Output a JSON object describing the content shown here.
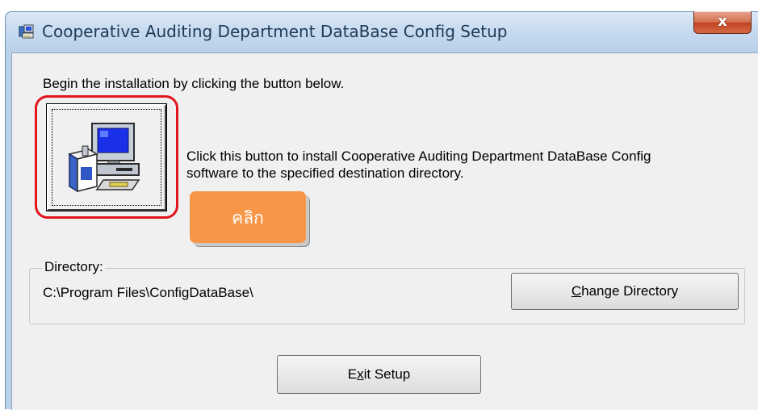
{
  "window": {
    "title": "Cooperative Auditing Department DataBase Config Setup",
    "close_label": "x"
  },
  "main": {
    "instruction": "Begin the installation by clicking the button below.",
    "install_description_line1": "Click this button to install Cooperative Auditing Department DataBase Config",
    "install_description_line2": "software to the specified destination directory.",
    "install_button_icon": "setup-computer-icon"
  },
  "annotation": {
    "callout_text": "คลิก",
    "highlight_color": "#e2141c",
    "callout_color": "#f79646"
  },
  "directory": {
    "group_label": "Directory:",
    "path": "C:\\Program Files\\ConfigDataBase\\",
    "change_button": {
      "pre": "",
      "mnemonic": "C",
      "post": "hange Directory"
    }
  },
  "footer": {
    "exit_button": {
      "pre": "E",
      "mnemonic": "x",
      "post": "it Setup"
    }
  }
}
